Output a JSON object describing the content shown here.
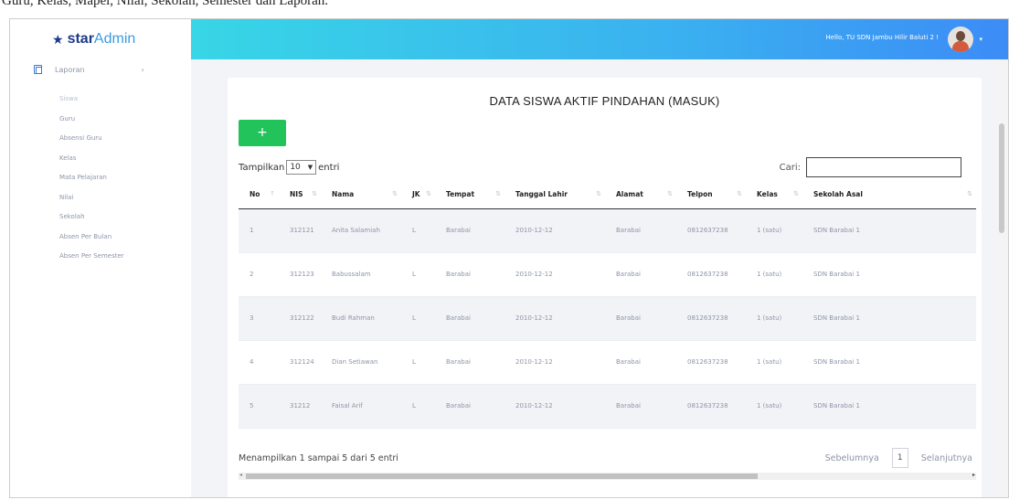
{
  "caption": "Guru, Kelas, Mapel, Nilai, Sekolah, Semester dan Laporan.",
  "brand": {
    "bold": "star",
    "light": "Admin"
  },
  "sidebar": {
    "section_label": "Laporan",
    "items": [
      "Siswa",
      "Guru",
      "Absensi Guru",
      "Kelas",
      "Mata Pelajaran",
      "Nilai",
      "Sekolah",
      "Absen Per Bulan",
      "Absen Per Semester"
    ]
  },
  "topbar": {
    "greeting": "Hello, TU SDN Jambu Hilir Baluti 2 !"
  },
  "page": {
    "title": "DATA SISWA AKTIF PINDAHAN (MASUK)",
    "add_label": "+",
    "length_prefix": "Tampilkan",
    "length_value": "10",
    "length_suffix": "entri",
    "search_label": "Cari:",
    "search_value": "",
    "columns": [
      "No",
      "NIS",
      "Nama",
      "JK",
      "Tempat",
      "Tanggal Lahir",
      "Alamat",
      "Telpon",
      "Kelas",
      "Sekolah Asal"
    ],
    "rows": [
      [
        "1",
        "312121",
        "Anita Salamiah",
        "L",
        "Barabai",
        "2010-12-12",
        "Barabai",
        "0812637238",
        "1 (satu)",
        "SDN Barabai 1"
      ],
      [
        "2",
        "312123",
        "Babussalam",
        "L",
        "Barabai",
        "2010-12-12",
        "Barabai",
        "0812637238",
        "1 (satu)",
        "SDN Barabai 1"
      ],
      [
        "3",
        "312122",
        "Budi Rahman",
        "L",
        "Barabai",
        "2010-12-12",
        "Barabai",
        "0812637238",
        "1 (satu)",
        "SDN Barabai 1"
      ],
      [
        "4",
        "312124",
        "Dian Setiawan",
        "L",
        "Barabai",
        "2010-12-12",
        "Barabai",
        "0812637238",
        "1 (satu)",
        "SDN Barabai 1"
      ],
      [
        "5",
        "31212",
        "Faisal Arif",
        "L",
        "Barabai",
        "2010-12-12",
        "Barabai",
        "0812637238",
        "1 (satu)",
        "SDN Barabai 1"
      ]
    ],
    "info": "Menampilkan 1 sampai 5 dari 5 entri",
    "prev": "Sebelumnya",
    "page_num": "1",
    "next": "Selanjutnya"
  },
  "colors": {
    "accent_from": "#38d6e6",
    "accent_to": "#3c8cf6",
    "add_button": "#23c35b",
    "brand": "#1b3a8a"
  }
}
